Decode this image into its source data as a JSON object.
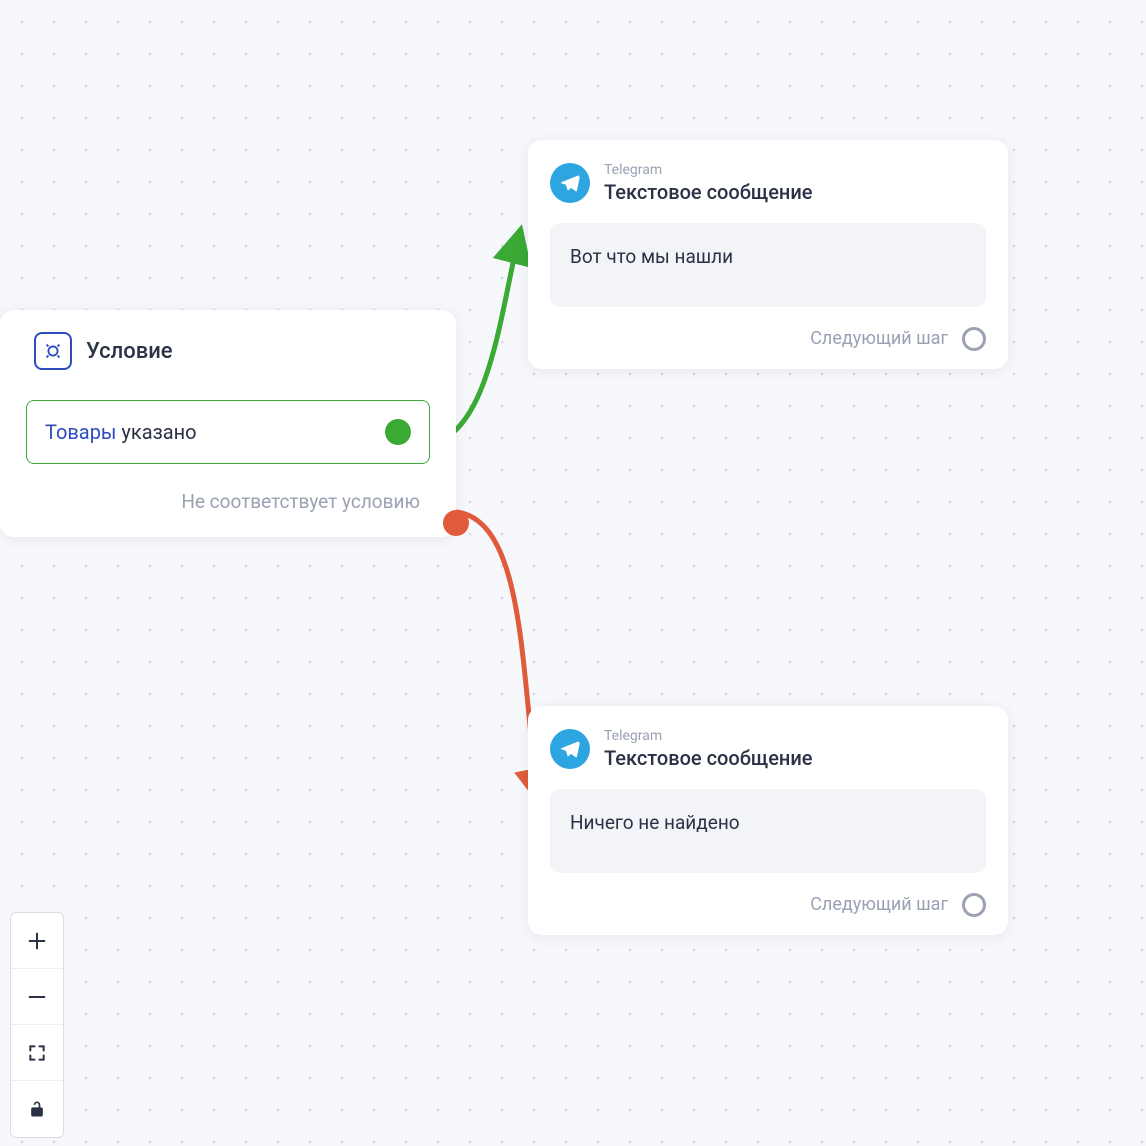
{
  "condition_node": {
    "title": "Условие",
    "branch": {
      "variable": "Товары",
      "text": "указано"
    },
    "else_label": "Не соответствует условию"
  },
  "message_nodes": {
    "top": {
      "channel_label": "Telegram",
      "type_label": "Текстовое сообщение",
      "body": "Вот что мы нашли",
      "next_label": "Следующий шаг"
    },
    "bottom": {
      "channel_label": "Telegram",
      "type_label": "Текстовое сообщение",
      "body": "Ничего не найдено",
      "next_label": "Следующий шаг"
    }
  },
  "colors": {
    "green": "#3aaa35",
    "red": "#e05b3b",
    "telegram": "#2ca5e0",
    "accent_blue": "#2d4dbf"
  }
}
